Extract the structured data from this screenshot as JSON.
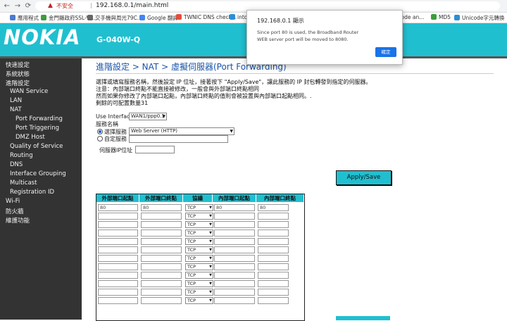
{
  "browser": {
    "security_label": "不安全",
    "url": "192.168.0.1/main.html",
    "bookmarks": [
      {
        "label": "應用程式",
        "color": "#4a7bd0"
      },
      {
        "label": "金門縣政府SSL-VP...",
        "color": "#3a9d3a"
      },
      {
        "label": "交手機與周光79C...",
        "color": "#666666"
      },
      {
        "label": "Google 翻譯",
        "color": "#4285f4"
      },
      {
        "label": "TWNIC DNS check...",
        "color": "#e74c3c"
      },
      {
        "label": "intoDN",
        "color": "#2a8fd6"
      },
      {
        "label": "decode an...",
        "color": "#888888"
      },
      {
        "label": "MD5",
        "color": "#3a9d3a"
      },
      {
        "label": "Unicode字元轉換",
        "color": "#2a8fd6"
      }
    ]
  },
  "header": {
    "logo": "NOKIA",
    "model": "G-040W-Q"
  },
  "sidebar": {
    "items": [
      {
        "label": "快速設定",
        "indent": 0
      },
      {
        "label": "系統狀態",
        "indent": 0
      },
      {
        "label": "進階設定",
        "indent": 0
      },
      {
        "label": "WAN Service",
        "indent": 1
      },
      {
        "label": "LAN",
        "indent": 1
      },
      {
        "label": "NAT",
        "indent": 1
      },
      {
        "label": "Port Forwarding",
        "indent": 2
      },
      {
        "label": "Port Triggering",
        "indent": 2
      },
      {
        "label": "DMZ Host",
        "indent": 2
      },
      {
        "label": "Quality of Service",
        "indent": 1
      },
      {
        "label": "Routing",
        "indent": 1
      },
      {
        "label": "DNS",
        "indent": 1
      },
      {
        "label": "Interface Grouping",
        "indent": 1
      },
      {
        "label": "Multicast",
        "indent": 1
      },
      {
        "label": "Registration ID",
        "indent": 1
      },
      {
        "label": "Wi-Fi",
        "indent": 0
      },
      {
        "label": "防火牆",
        "indent": 0
      },
      {
        "label": "維護功能",
        "indent": 0
      }
    ]
  },
  "main": {
    "title": "進階設定 > NAT > 虛擬伺服器(Port Forwarding)",
    "desc": [
      "選擇或填寫服務名稱，然後設定 IP 位址，接著按下 \"Apply/Save\"，讓此服務的 IP 封包轉發到指定的伺服器。",
      "注意：內部端口終點不能直接被修改，一般會與外部端口終點相同",
      "然而如果你修改了內部端口起點，內部端口終點的值則會被設置與內部端口起點相同。.",
      "剩餘的可配置數量31"
    ],
    "use_interface_label": "Use Interface",
    "use_interface_value": "WAN1/ppp0.1",
    "service_name_label": "服務名稱",
    "select_service_label": "選擇服務",
    "select_service_value": "Web Server (HTTP)",
    "custom_service_label": "自定服務",
    "server_ip_label": "伺服器IP位址",
    "apply_label": "Apply/Save"
  },
  "table": {
    "headers": [
      "外部端口起點",
      "外部端口終點",
      "協議",
      "內部端口起點",
      "內部端口終點"
    ],
    "rows": [
      [
        "80",
        "80",
        "TCP",
        "80",
        "80"
      ],
      [
        "",
        "",
        "TCP",
        "",
        ""
      ],
      [
        "",
        "",
        "TCP",
        "",
        ""
      ],
      [
        "",
        "",
        "TCP",
        "",
        ""
      ],
      [
        "",
        "",
        "TCP",
        "",
        ""
      ],
      [
        "",
        "",
        "TCP",
        "",
        ""
      ],
      [
        "",
        "",
        "TCP",
        "",
        ""
      ],
      [
        "",
        "",
        "TCP",
        "",
        ""
      ],
      [
        "",
        "",
        "TCP",
        "",
        ""
      ],
      [
        "",
        "",
        "TCP",
        "",
        ""
      ],
      [
        "",
        "",
        "TCP",
        "",
        ""
      ],
      [
        "",
        "",
        "TCP",
        "",
        ""
      ]
    ]
  },
  "dialog": {
    "title": "192.168.0.1 顯示",
    "message_line1": "Since port 80 is used, the Broadband Router",
    "message_line2": "WEB server port will be moved to 8080.",
    "ok_label": "確定"
  },
  "colors": {
    "accent": "#20bfd0",
    "sidebar": "#333333",
    "title": "#1a55a8"
  }
}
